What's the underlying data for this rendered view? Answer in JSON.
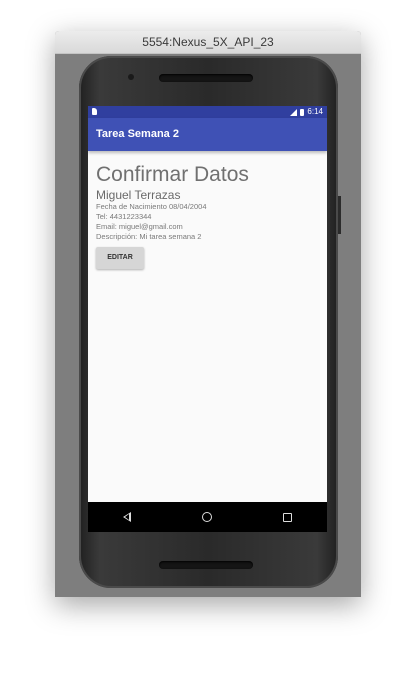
{
  "window": {
    "title": "5554:Nexus_5X_API_23"
  },
  "statusbar": {
    "time": "6:14"
  },
  "app": {
    "title": "Tarea Semana 2"
  },
  "main": {
    "heading": "Confirmar Datos",
    "name": "Miguel Terrazas",
    "birth": "Fecha de Nacimiento 08/04/2004",
    "phone": "Tel: 4431223344",
    "email": "Email: miguel@gmail.com",
    "description": "Descripción: Mi tarea semana 2",
    "edit_label": "EDITAR"
  },
  "navbar": {
    "icons": [
      "back-icon",
      "home-icon",
      "recents-icon"
    ]
  },
  "colors": {
    "primary": "#3f51b5",
    "primary_dark": "#303f9f",
    "screen_bg": "#fafafa"
  }
}
